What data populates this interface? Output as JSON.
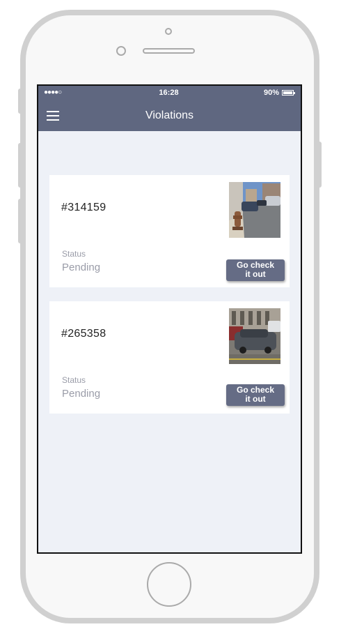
{
  "status_bar": {
    "signal": "●●●●○",
    "time": "16:28",
    "battery": "90%"
  },
  "nav": {
    "title": "Violations"
  },
  "violations": [
    {
      "id": "#314159",
      "status_label": "Status",
      "status": "Pending",
      "button_line1": "Go check",
      "button_line2": "it out"
    },
    {
      "id": "#265358",
      "status_label": "Status",
      "status": "Pending",
      "button_line1": "Go check",
      "button_line2": "it out"
    }
  ],
  "colors": {
    "header": "#5f6780",
    "screen_background": "#eef1f7",
    "button": "#656c85"
  }
}
